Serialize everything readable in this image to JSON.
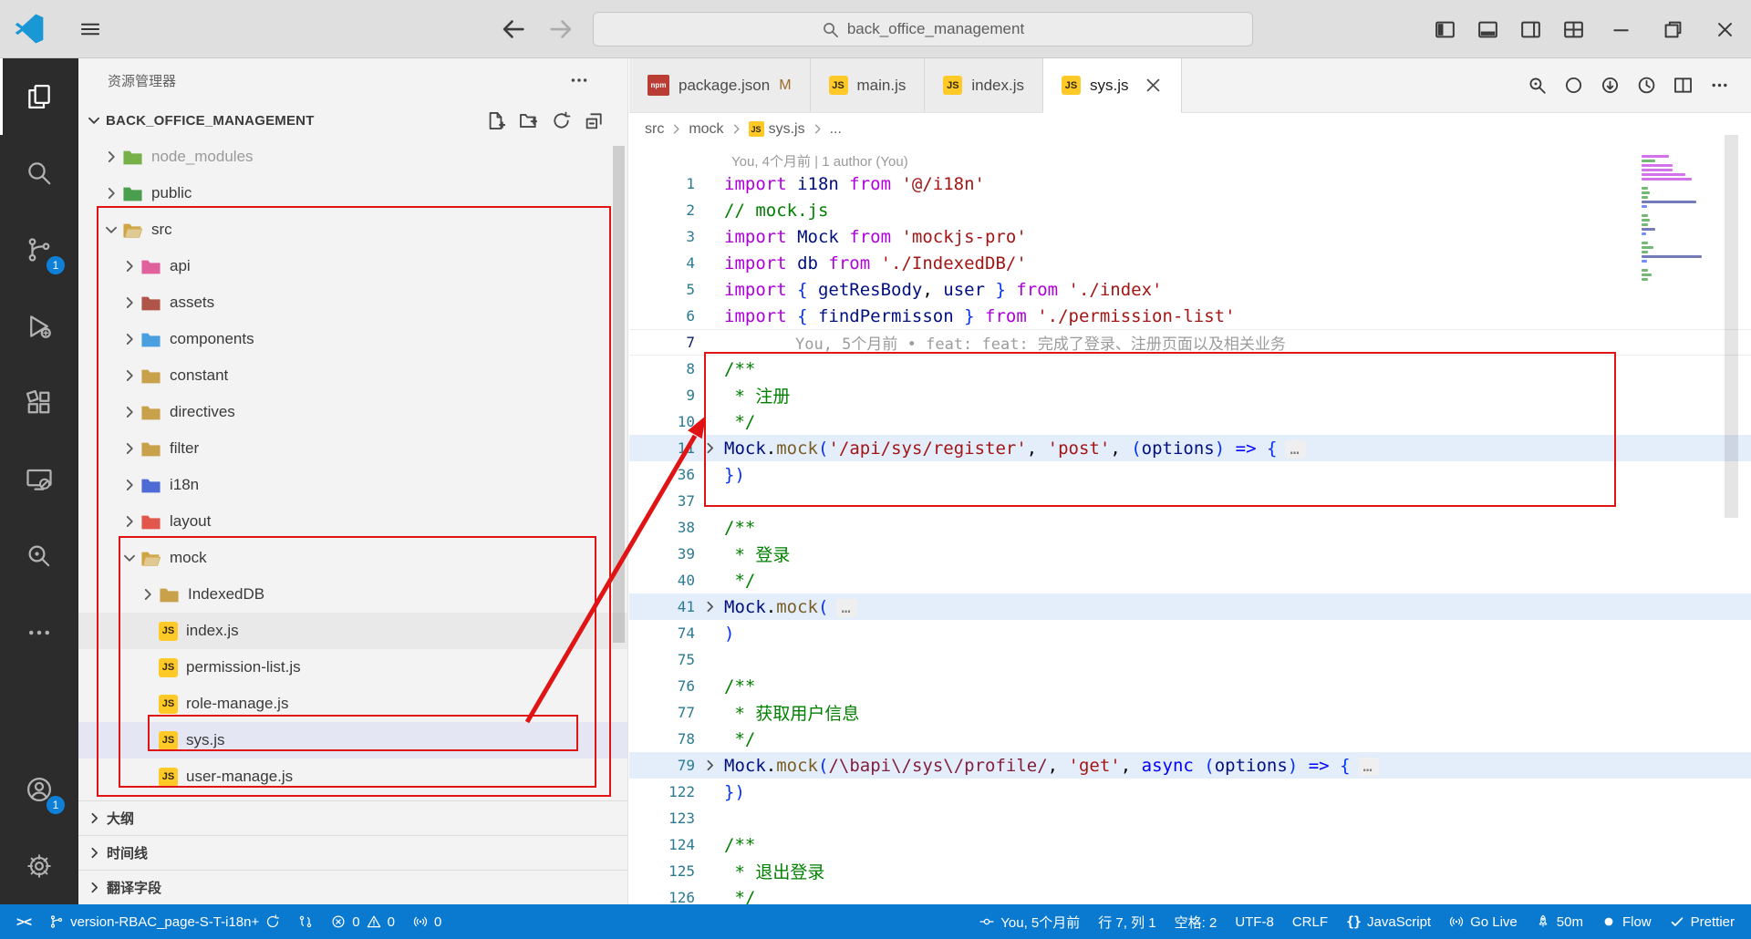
{
  "window": {
    "search_value": "back_office_management",
    "layout_buttons": [
      {
        "name": "toggle-primary-sidebar",
        "icon": "layout-left"
      },
      {
        "name": "toggle-panel",
        "icon": "layout-bottom"
      },
      {
        "name": "toggle-secondary-sidebar",
        "icon": "layout-right"
      },
      {
        "name": "customize-layout",
        "icon": "layout-grid"
      }
    ],
    "controls": [
      {
        "name": "minimize",
        "icon": "minimize"
      },
      {
        "name": "restore",
        "icon": "restore"
      },
      {
        "name": "close",
        "icon": "close"
      }
    ]
  },
  "icons": {
    "js": "JS",
    "npm": "npm",
    "remote": "><",
    "braces": "{}"
  },
  "activity_bar": {
    "items": [
      {
        "name": "explorer",
        "icon": "files",
        "active": true
      },
      {
        "name": "search",
        "icon": "search-big"
      },
      {
        "name": "source-control",
        "icon": "branch",
        "badge": "1"
      },
      {
        "name": "run-debug",
        "icon": "debug"
      },
      {
        "name": "extensions",
        "icon": "extensions"
      },
      {
        "name": "remote-explorer",
        "icon": "monitor"
      },
      {
        "name": "gitlens-inspect",
        "icon": "inspect"
      },
      {
        "name": "more-views",
        "icon": "more"
      }
    ],
    "bottom": [
      {
        "name": "accounts",
        "icon": "account",
        "badge": "1"
      },
      {
        "name": "settings",
        "icon": "gear"
      }
    ]
  },
  "sidebar": {
    "title": "资源管理器",
    "section": "BACK_OFFICE_MANAGEMENT",
    "actions": [
      {
        "name": "new-file",
        "icon": "new-file"
      },
      {
        "name": "new-folder",
        "icon": "new-folder"
      },
      {
        "name": "refresh-explorer",
        "icon": "refresh"
      },
      {
        "name": "collapse-folders",
        "icon": "collapse"
      }
    ],
    "tree": [
      {
        "label": "node_modules",
        "level": 0,
        "kind": "folder",
        "chevron": "right",
        "color": "#76b046",
        "muted": true
      },
      {
        "label": "public",
        "level": 0,
        "kind": "folder",
        "chevron": "right",
        "color": "#4a9e4e"
      },
      {
        "label": "src",
        "level": 0,
        "kind": "folder-open",
        "chevron": "down",
        "color": "#cfa543"
      },
      {
        "label": "api",
        "level": 1,
        "kind": "folder",
        "chevron": "right",
        "color": "#e0619b"
      },
      {
        "label": "assets",
        "level": 1,
        "kind": "folder",
        "chevron": "right",
        "color": "#b05449"
      },
      {
        "label": "components",
        "level": 1,
        "kind": "folder",
        "chevron": "right",
        "color": "#4a9fe0"
      },
      {
        "label": "constant",
        "level": 1,
        "kind": "folder",
        "chevron": "right",
        "color": "#c9a14b"
      },
      {
        "label": "directives",
        "level": 1,
        "kind": "folder",
        "chevron": "right",
        "color": "#c9a14b"
      },
      {
        "label": "filter",
        "level": 1,
        "kind": "folder",
        "chevron": "right",
        "color": "#c9a14b"
      },
      {
        "label": "i18n",
        "level": 1,
        "kind": "folder",
        "chevron": "right",
        "color": "#4f6bd6"
      },
      {
        "label": "layout",
        "level": 1,
        "kind": "folder",
        "chevron": "right",
        "color": "#e2574c"
      },
      {
        "label": "mock",
        "level": 1,
        "kind": "folder-open",
        "chevron": "down",
        "color": "#cfa543"
      },
      {
        "label": "IndexedDB",
        "level": 2,
        "kind": "folder",
        "chevron": "right",
        "color": "#c9a14b"
      },
      {
        "label": "index.js",
        "level": 2,
        "kind": "js",
        "hover": true
      },
      {
        "label": "permission-list.js",
        "level": 2,
        "kind": "js"
      },
      {
        "label": "role-manage.js",
        "level": 2,
        "kind": "js"
      },
      {
        "label": "sys.js",
        "level": 2,
        "kind": "js",
        "selected": true
      },
      {
        "label": "user-manage.js",
        "level": 2,
        "kind": "js"
      }
    ],
    "panels": [
      {
        "label": "大纲"
      },
      {
        "label": "时间线"
      },
      {
        "label": "翻译字段"
      }
    ]
  },
  "tabs": [
    {
      "label": "package.json",
      "icon": "npm",
      "badge": "M"
    },
    {
      "label": "main.js",
      "icon": "js"
    },
    {
      "label": "index.js",
      "icon": "js"
    },
    {
      "label": "sys.js",
      "icon": "js",
      "active": true,
      "close": true
    }
  ],
  "breadcrumb": [
    {
      "label": "src"
    },
    {
      "label": "mock"
    },
    {
      "label": "sys.js",
      "icon": "js"
    },
    {
      "label": "..."
    }
  ],
  "editor": {
    "codelens": "You, 4个月前 | 1 author (You)",
    "blame_line7": "You, 5个月前 • feat: feat: 完成了登录、注册页面以及相关业务",
    "fold_ellipsis": "…",
    "actions": [
      {
        "name": "gitlens-file-annotations",
        "icon": "inspect16"
      },
      {
        "name": "open-changes",
        "icon": "ring"
      },
      {
        "name": "open-changes-with",
        "icon": "ring-arrow"
      },
      {
        "name": "timeline",
        "icon": "history"
      },
      {
        "name": "split-editor",
        "icon": "split"
      },
      {
        "name": "more-actions",
        "icon": "more16"
      }
    ],
    "lines": [
      {
        "n": 1,
        "t": [
          [
            "k",
            "import "
          ],
          [
            "v",
            "i18n"
          ],
          [
            "k",
            " from "
          ],
          [
            "s",
            "'@/i18n'"
          ]
        ]
      },
      {
        "n": 2,
        "t": [
          [
            "c",
            "// mock.js"
          ]
        ]
      },
      {
        "n": 3,
        "t": [
          [
            "k",
            "import "
          ],
          [
            "v",
            "Mock"
          ],
          [
            "k",
            " from "
          ],
          [
            "s",
            "'mockjs-pro'"
          ]
        ]
      },
      {
        "n": 4,
        "t": [
          [
            "k",
            "import "
          ],
          [
            "v",
            "db"
          ],
          [
            "k",
            " from "
          ],
          [
            "s",
            "'./IndexedDB/'"
          ]
        ]
      },
      {
        "n": 5,
        "t": [
          [
            "k",
            "import "
          ],
          [
            "br",
            "{ "
          ],
          [
            "v",
            "getResBody"
          ],
          [
            "p",
            ", "
          ],
          [
            "v",
            "user"
          ],
          [
            "br",
            " } "
          ],
          [
            "k",
            "from "
          ],
          [
            "s",
            "'./index'"
          ]
        ]
      },
      {
        "n": 6,
        "t": [
          [
            "k",
            "import "
          ],
          [
            "br",
            "{ "
          ],
          [
            "v",
            "findPermisson"
          ],
          [
            "br",
            " } "
          ],
          [
            "k",
            "from "
          ],
          [
            "s",
            "'./permission-list'"
          ]
        ]
      },
      {
        "n": 7,
        "t": [],
        "blame": true,
        "current": true
      },
      {
        "n": 8,
        "t": [
          [
            "c",
            "/**"
          ]
        ]
      },
      {
        "n": 9,
        "t": [
          [
            "c",
            " * 注册"
          ]
        ]
      },
      {
        "n": 10,
        "t": [
          [
            "c",
            " */"
          ]
        ]
      },
      {
        "n": 11,
        "t": [
          [
            "v",
            "Mock"
          ],
          [
            "p",
            "."
          ],
          [
            "f",
            "mock"
          ],
          [
            "br",
            "("
          ],
          [
            "s",
            "'/api/sys/register'"
          ],
          [
            "p",
            ", "
          ],
          [
            "s",
            "'post'"
          ],
          [
            "p",
            ", "
          ],
          [
            "br",
            "("
          ],
          [
            "v",
            "options"
          ],
          [
            "br",
            ")"
          ],
          [
            "p",
            " "
          ],
          [
            "b",
            "=>"
          ],
          [
            "p",
            " "
          ],
          [
            "br",
            "{"
          ]
        ],
        "fold": true,
        "hl": true
      },
      {
        "n": 36,
        "t": [
          [
            "br",
            "})"
          ]
        ]
      },
      {
        "n": 37,
        "t": []
      },
      {
        "n": 38,
        "t": [
          [
            "c",
            "/**"
          ]
        ]
      },
      {
        "n": 39,
        "t": [
          [
            "c",
            " * 登录"
          ]
        ]
      },
      {
        "n": 40,
        "t": [
          [
            "c",
            " */"
          ]
        ]
      },
      {
        "n": 41,
        "t": [
          [
            "v",
            "Mock"
          ],
          [
            "p",
            "."
          ],
          [
            "f",
            "mock"
          ],
          [
            "br",
            "("
          ]
        ],
        "fold": true,
        "hl": true
      },
      {
        "n": 74,
        "t": [
          [
            "br",
            ")"
          ]
        ]
      },
      {
        "n": 75,
        "t": []
      },
      {
        "n": 76,
        "t": [
          [
            "c",
            "/**"
          ]
        ]
      },
      {
        "n": 77,
        "t": [
          [
            "c",
            " * 获取用户信息"
          ]
        ]
      },
      {
        "n": 78,
        "t": [
          [
            "c",
            " */"
          ]
        ]
      },
      {
        "n": 79,
        "t": [
          [
            "v",
            "Mock"
          ],
          [
            "p",
            "."
          ],
          [
            "f",
            "mock"
          ],
          [
            "br",
            "("
          ],
          [
            "r",
            "/\\bapi\\/sys\\/profile/"
          ],
          [
            "p",
            ", "
          ],
          [
            "s",
            "'get'"
          ],
          [
            "p",
            ", "
          ],
          [
            "b",
            "async "
          ],
          [
            "br",
            "("
          ],
          [
            "v",
            "options"
          ],
          [
            "br",
            ")"
          ],
          [
            "p",
            " "
          ],
          [
            "b",
            "=>"
          ],
          [
            "p",
            " "
          ],
          [
            "br",
            "{"
          ]
        ],
        "fold": true,
        "hl": true
      },
      {
        "n": 122,
        "t": [
          [
            "br",
            "})"
          ]
        ]
      },
      {
        "n": 123,
        "t": []
      },
      {
        "n": 124,
        "t": [
          [
            "c",
            "/**"
          ]
        ]
      },
      {
        "n": 125,
        "t": [
          [
            "c",
            " * 退出登录"
          ]
        ]
      },
      {
        "n": 126,
        "t": [
          [
            "c",
            " */"
          ]
        ]
      }
    ]
  },
  "status_bar": {
    "left": [
      {
        "name": "remote",
        "icon_text": "remote"
      },
      {
        "name": "branch",
        "icon": "branch16",
        "label": "version-RBAC_page-S-T-i18n+",
        "icon_after": "sync"
      },
      {
        "name": "git-compare",
        "icon": "compare"
      },
      {
        "name": "problems",
        "parts": [
          {
            "icon": "error",
            "label": "0"
          },
          {
            "icon": "warn",
            "label": "0"
          }
        ]
      },
      {
        "name": "ports",
        "icon": "radio",
        "label": "0"
      }
    ],
    "right": [
      {
        "name": "gitlens-blame",
        "icon": "commit",
        "label": "You, 5个月前"
      },
      {
        "name": "cursor-position",
        "label": "行 7, 列 1"
      },
      {
        "name": "indentation",
        "label": "空格: 2"
      },
      {
        "name": "encoding",
        "label": "UTF-8"
      },
      {
        "name": "eol",
        "label": "CRLF"
      },
      {
        "name": "language",
        "icon_text": "braces",
        "label": "JavaScript"
      },
      {
        "name": "go-live",
        "icon": "radio",
        "label": "Go Live"
      },
      {
        "name": "wakatime",
        "icon": "rocket",
        "label": "50m"
      },
      {
        "name": "flow",
        "icon": "dot",
        "label": "Flow"
      },
      {
        "name": "prettier",
        "icon": "check",
        "label": "Prettier"
      }
    ]
  }
}
